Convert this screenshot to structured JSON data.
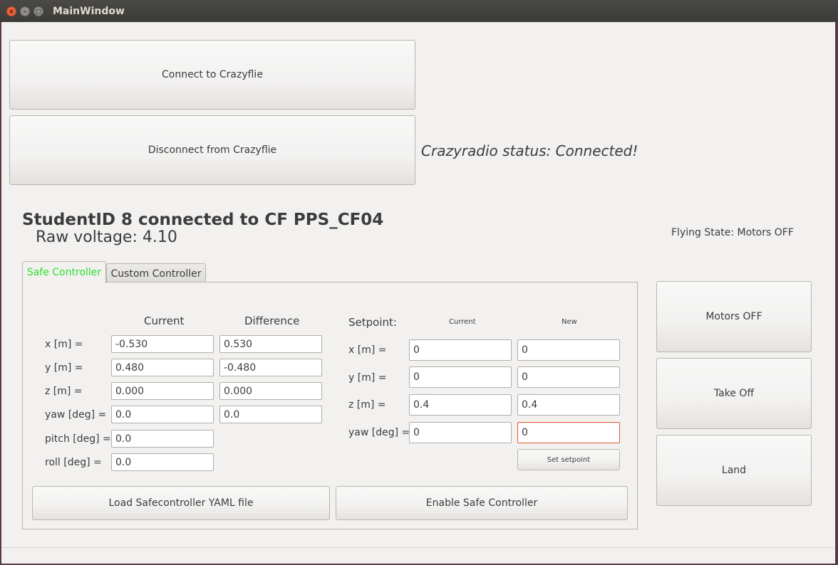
{
  "window": {
    "title": "MainWindow",
    "close_glyph": "×",
    "minimize_glyph": "–",
    "maximize_glyph": "□"
  },
  "connection": {
    "connect_label": "Connect to Crazyflie",
    "disconnect_label": "Disconnect from Crazyflie",
    "crazyradio_status": "Crazyradio status: Connected!"
  },
  "info": {
    "student_line": "StudentID 8 connected to CF PPS_CF04",
    "raw_voltage": "Raw voltage: 4.10",
    "flying_state": "Flying State: Motors OFF"
  },
  "tabs": {
    "safe": "Safe Controller",
    "custom": "Custom Controller"
  },
  "state_table": {
    "header_current": "Current",
    "header_difference": "Difference",
    "rows": [
      {
        "label": "x [m] =",
        "current": "-0.530",
        "difference": "0.530"
      },
      {
        "label": "y [m] =",
        "current": "0.480",
        "difference": "-0.480"
      },
      {
        "label": "z [m] =",
        "current": "0.000",
        "difference": "0.000"
      },
      {
        "label": "yaw [deg] =",
        "current": "0.0",
        "difference": "0.0"
      },
      {
        "label": "pitch [deg] =",
        "current": "0.0"
      },
      {
        "label": "roll [deg] =",
        "current": "0.0"
      }
    ]
  },
  "setpoint": {
    "title": "Setpoint:",
    "header_current": "Current",
    "header_new": "New",
    "rows": [
      {
        "label": "x [m] =",
        "current": "0",
        "new": "0"
      },
      {
        "label": "y [m] =",
        "current": "0",
        "new": "0"
      },
      {
        "label": "z [m] =",
        "current": "0.4",
        "new": "0.4"
      },
      {
        "label": "yaw [deg] =",
        "current": "0",
        "new": "0"
      }
    ],
    "set_button": "Set setpoint"
  },
  "actions": {
    "load_yaml": "Load Safecontroller YAML file",
    "enable_safe": "Enable Safe Controller"
  },
  "flight": {
    "motors_off": "Motors OFF",
    "take_off": "Take Off",
    "land": "Land"
  },
  "colors": {
    "active_tab_text": "#2ee02e",
    "focused_field_border": "#e0562a",
    "close_button": "#e9623a"
  }
}
